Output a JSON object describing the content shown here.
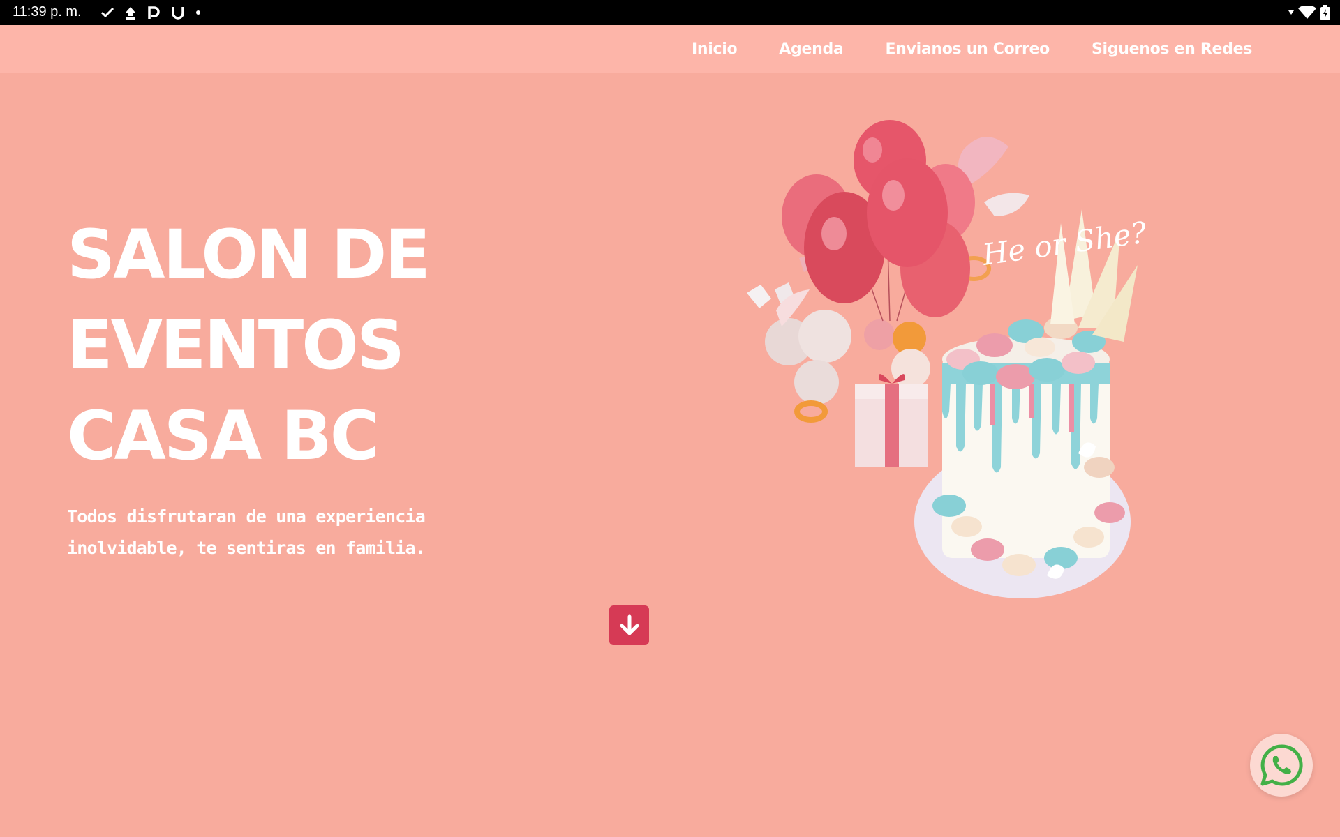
{
  "status_bar": {
    "time": "11:39 p. m.",
    "icons": [
      "check-icon",
      "upload-icon",
      "p-app-icon",
      "u-app-icon",
      "dot-icon"
    ],
    "right_icons": [
      "wifi-icon",
      "battery-icon"
    ]
  },
  "nav": {
    "items": [
      {
        "label": "Inicio"
      },
      {
        "label": "Agenda"
      },
      {
        "label": "Envianos un Correo"
      },
      {
        "label": "Siguenos en Redes"
      }
    ]
  },
  "hero": {
    "title_lines": [
      "SALON DE",
      "EVENTOS",
      "CASA BC"
    ],
    "subtitle": "Todos disfrutaran de una experiencia inolvidable, te sentiras en familia.",
    "image_topper_text": "He or She?"
  },
  "colors": {
    "background": "#f8ab9d",
    "navbar": "#fdb5a9",
    "accent": "#d63a55",
    "whatsapp": "#4caf50"
  },
  "floating": {
    "whatsapp_icon": "whatsapp-icon",
    "scroll_icon": "arrow-down-icon"
  }
}
